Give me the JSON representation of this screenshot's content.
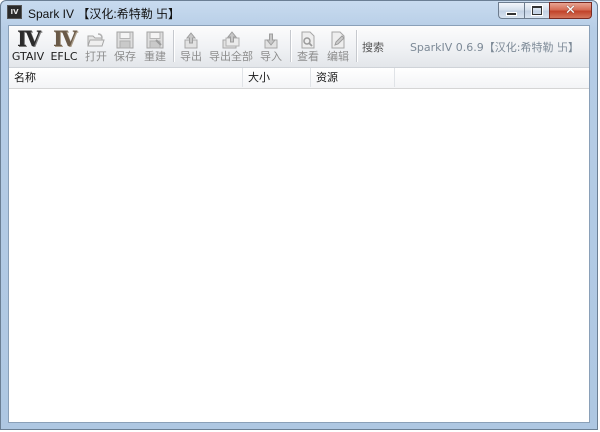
{
  "window": {
    "title": "Spark IV 【汉化:希特勒 卐】",
    "app_icon_text": "IV",
    "controls": {
      "minimize": "minimize",
      "maximize": "maximize",
      "close": "✕"
    }
  },
  "toolbar": {
    "gtaiv": {
      "logo": "IV",
      "label": "GTAIV"
    },
    "eflc": {
      "logo": "IV",
      "label": "EFLC"
    },
    "open": "打开",
    "save": "保存",
    "rebuild": "重建",
    "export": "导出",
    "export_all": "导出全部",
    "import": "导入",
    "view": "查看",
    "edit": "编辑",
    "search": "搜索",
    "version": "SparkIV 0.6.9【汉化:希特勒 卐】"
  },
  "list": {
    "columns": [
      "名称",
      "大小",
      "资源"
    ],
    "rows": []
  },
  "colors": {
    "titlebar": "#b6cde6",
    "close_button": "#c2432a",
    "disabled_text": "#8d8d8d",
    "list_background": "#ffffff"
  }
}
